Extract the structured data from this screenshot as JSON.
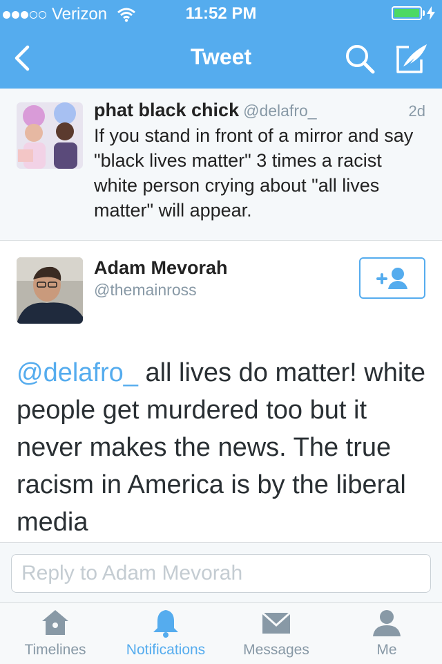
{
  "colors": {
    "accent": "#55acee",
    "battery": "#4cd964",
    "muted": "#8899a6",
    "text": "#222222"
  },
  "status_bar": {
    "carrier": "Verizon",
    "time": "11:52 PM"
  },
  "nav": {
    "title": "Tweet",
    "back_icon": "chevron-left-icon",
    "search_icon": "search-icon",
    "compose_icon": "compose-icon"
  },
  "quoted_tweet": {
    "name": "phat black chick",
    "handle": "@delafro_",
    "time": "2d",
    "text": "If you stand in front of a mirror and say \"black lives matter\" 3 times a racist white person crying about \"all lives matter\" will appear."
  },
  "main_tweet": {
    "name": "Adam Mevorah",
    "handle": "@themainross",
    "mention": "@delafro_",
    "text": " all lives do matter! white people get murdered too but it never makes the news. The true racism in America is by the liberal media",
    "follow_icon": "add-user-icon"
  },
  "reply": {
    "placeholder": "Reply to Adam Mevorah"
  },
  "tabs": [
    {
      "label": "Timelines",
      "icon": "home-icon",
      "active": false
    },
    {
      "label": "Notifications",
      "icon": "bell-icon",
      "active": true
    },
    {
      "label": "Messages",
      "icon": "envelope-icon",
      "active": false
    },
    {
      "label": "Me",
      "icon": "person-icon",
      "active": false
    }
  ]
}
